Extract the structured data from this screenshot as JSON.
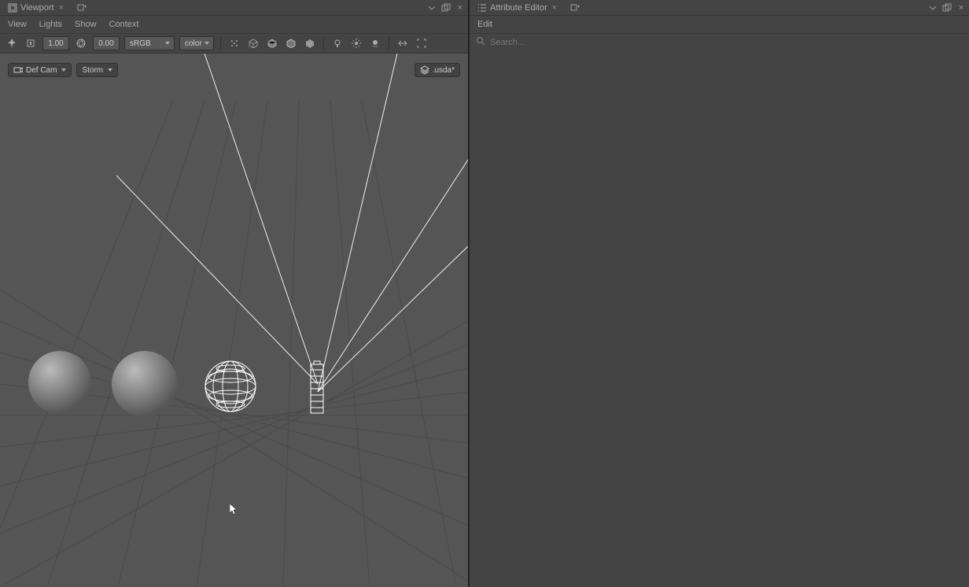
{
  "left": {
    "tab": {
      "title": "Viewport"
    },
    "menu": {
      "view": "View",
      "lights": "Lights",
      "show": "Show",
      "context": "Context"
    },
    "toolbar": {
      "exposure": "1.00",
      "gamma": "0.00",
      "colorspace": "sRGB",
      "channel": "color"
    },
    "overlay": {
      "camera": "Def Cam",
      "renderer": "Storm",
      "stage": ".usda*"
    }
  },
  "right": {
    "tab": {
      "title": "Attribute Editor"
    },
    "menu": {
      "edit": "Edit"
    },
    "search": {
      "placeholder": "Search..."
    }
  }
}
